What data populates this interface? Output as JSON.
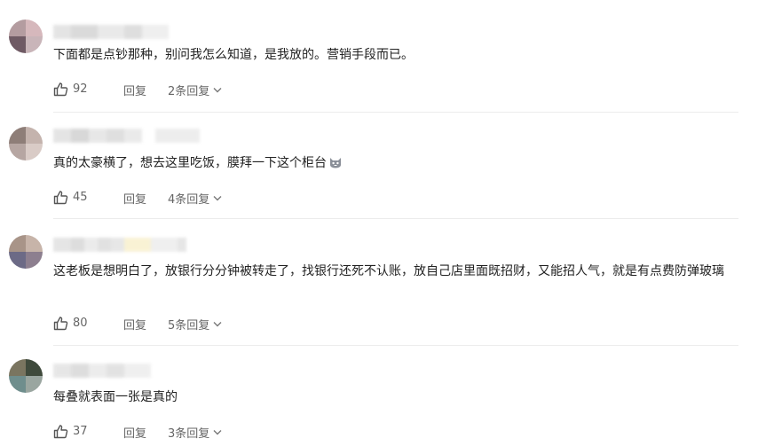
{
  "ui": {
    "accent": "#555555",
    "reply_label": "回复"
  },
  "comments": [
    {
      "text": "下面都是点钞那种，别问我怎么知道，是我放的。营销手段而已。",
      "likes": "92",
      "replies_label": "2条回复"
    },
    {
      "text": "真的太豪横了，想去这里吃饭，膜拜一下这个柜台",
      "emoji": "cat-face-emoji",
      "likes": "45",
      "replies_label": "4条回复"
    },
    {
      "text": "这老板是想明白了，放银行分分钟被转走了，找银行还死不认账，放自己店里面既招财，又能招人气，就是有点费防弹玻璃",
      "likes": "80",
      "replies_label": "5条回复"
    },
    {
      "text": "每叠就表面一张是真的",
      "likes": "37",
      "replies_label": "3条回复"
    }
  ],
  "icons": [
    "thumbs-up-icon",
    "chevron-down-icon"
  ]
}
